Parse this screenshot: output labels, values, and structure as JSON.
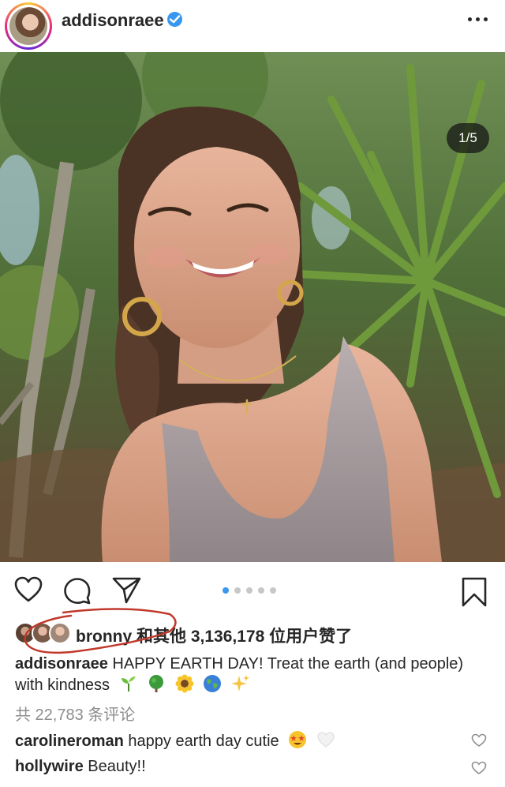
{
  "header": {
    "username": "addisonraee",
    "verified_icon": "verified-badge-icon",
    "more_icon": "more-options-icon"
  },
  "photo": {
    "counter": "1/5",
    "carousel_total": 5,
    "carousel_active_index": 0
  },
  "actions": {
    "like_icon": "heart-icon",
    "comment_icon": "comment-icon",
    "share_icon": "share-icon",
    "save_icon": "bookmark-icon"
  },
  "likes": {
    "text": "bronny 和其他 3,136,178 位用户赞了"
  },
  "caption": {
    "username": "addisonraee",
    "text": "HAPPY EARTH DAY! Treat the earth (and people) with kindness",
    "emojis": [
      "seedling-emoji",
      "tree-emoji",
      "sunflower-emoji",
      "globe-emoji",
      "sparkles-emoji"
    ]
  },
  "comments_count": "共 22,783 条评论",
  "comments": [
    {
      "username": "carolineroman",
      "text": "happy earth day cutie"
    },
    {
      "username": "hollywire",
      "text": "Beauty!!"
    }
  ],
  "colors": {
    "accent": "#3897f0",
    "text": "#262626",
    "muted": "#8e8e8e",
    "annotation": "#c0392b"
  }
}
